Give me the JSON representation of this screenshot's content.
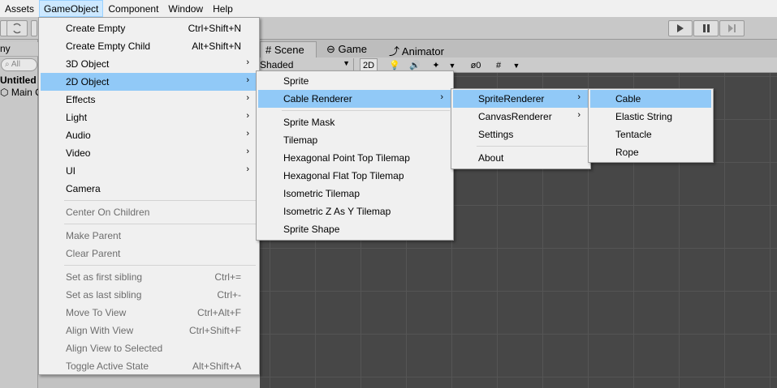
{
  "menubar": [
    "Assets",
    "GameObject",
    "Component",
    "Window",
    "Help"
  ],
  "toolbar": {
    "refresh_icon": "refresh-icon",
    "play_icon": "play-icon",
    "pause_icon": "pause-icon",
    "step_icon": "step-icon"
  },
  "hierarchy": {
    "tab_label": "ny",
    "search_placeholder": "All",
    "scene_name": "Untitled",
    "child_name": "Main C"
  },
  "scene": {
    "tabs": [
      "Scene",
      "Game",
      "Animator"
    ],
    "shading_mode": "Shaded",
    "toggle_2d": "2D",
    "hidden_count": "0",
    "grid_color": "#555555",
    "bg_color": "#474747"
  },
  "gameobject_menu": [
    {
      "label": "Create Empty",
      "shortcut": "Ctrl+Shift+N"
    },
    {
      "label": "Create Empty Child",
      "shortcut": "Alt+Shift+N"
    },
    {
      "label": "3D Object",
      "submenu": true
    },
    {
      "label": "2D Object",
      "submenu": true,
      "highlighted": true
    },
    {
      "label": "Effects",
      "submenu": true
    },
    {
      "label": "Light",
      "submenu": true
    },
    {
      "label": "Audio",
      "submenu": true
    },
    {
      "label": "Video",
      "submenu": true
    },
    {
      "label": "UI",
      "submenu": true
    },
    {
      "label": "Camera"
    },
    {
      "label": "Center On Children",
      "disabled": true
    },
    {
      "label": "Make Parent",
      "disabled": true
    },
    {
      "label": "Clear Parent",
      "disabled": true
    },
    {
      "label": "Set as first sibling",
      "shortcut": "Ctrl+=",
      "disabled": true
    },
    {
      "label": "Set as last sibling",
      "shortcut": "Ctrl+-",
      "disabled": true
    },
    {
      "label": "Move To View",
      "shortcut": "Ctrl+Alt+F",
      "disabled": true
    },
    {
      "label": "Align With View",
      "shortcut": "Ctrl+Shift+F",
      "disabled": true
    },
    {
      "label": "Align View to Selected",
      "disabled": true
    },
    {
      "label": "Toggle Active State",
      "shortcut": "Alt+Shift+A",
      "disabled": true
    }
  ],
  "object2d_menu": [
    {
      "label": "Sprite"
    },
    {
      "label": "Cable Renderer",
      "submenu": true,
      "highlighted": true
    },
    {
      "label": "Sprite Mask"
    },
    {
      "label": "Tilemap"
    },
    {
      "label": "Hexagonal Point Top Tilemap"
    },
    {
      "label": "Hexagonal Flat Top Tilemap"
    },
    {
      "label": "Isometric Tilemap"
    },
    {
      "label": "Isometric Z As Y Tilemap"
    },
    {
      "label": "Sprite Shape"
    }
  ],
  "cable_menu": [
    {
      "label": "SpriteRenderer",
      "submenu": true,
      "highlighted": true
    },
    {
      "label": "CanvasRenderer",
      "submenu": true
    },
    {
      "label": "Settings"
    },
    {
      "label": "About"
    }
  ],
  "sprite_renderer_menu": [
    {
      "label": "Cable",
      "highlighted": true
    },
    {
      "label": "Elastic String"
    },
    {
      "label": "Tentacle"
    },
    {
      "label": "Rope"
    }
  ],
  "colors": {
    "highlight": "#91c9f7",
    "menu_bg": "#f0f0f0",
    "active_menubar": "#cce8ff",
    "disabled_text": "#6d6d6d"
  }
}
